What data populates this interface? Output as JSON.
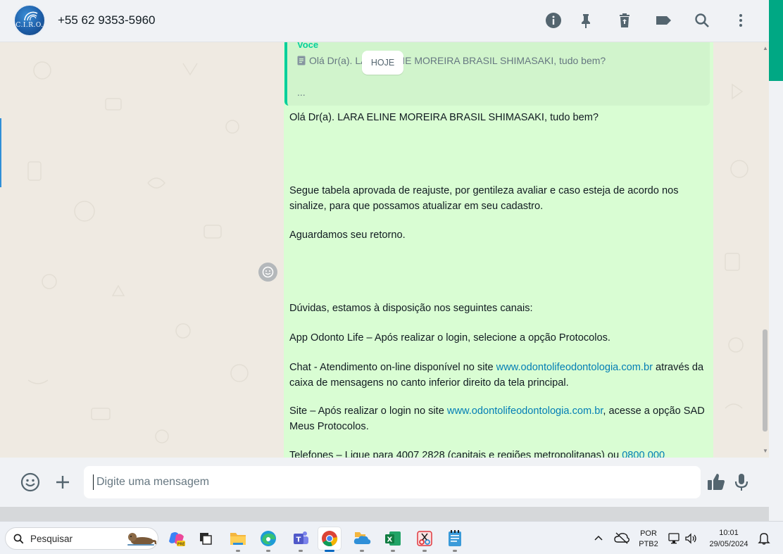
{
  "header": {
    "avatar_text": "C.I.R.O.",
    "contact_name": "+55 62 9353-5960",
    "icons": [
      "info-icon",
      "pin-icon",
      "delete-icon",
      "label-icon",
      "search-icon",
      "more-options-icon"
    ]
  },
  "chat": {
    "date_chip": "HOJE",
    "quoted": {
      "sender": "Você",
      "text": "Olá Dr(a). LARA ELINE MOREIRA BRASIL SHIMASAKI, tudo bem?",
      "ellipsis": "..."
    },
    "message": {
      "greeting": "Olá Dr(a). LARA ELINE MOREIRA BRASIL SHIMASAKI, tudo bem?",
      "p1": "Segue tabela aprovada de reajuste, por gentileza avaliar e caso esteja de acordo nos sinalize, para que possamos atualizar em seu cadastro.",
      "p2": "Aguardamos seu retorno.",
      "p3": "Dúvidas, estamos à disposição nos seguintes canais:",
      "p4": "App Odonto Life – Após realizar o login, selecione a opção Protocolos.",
      "p5_a": "Chat - Atendimento on-line disponível no site ",
      "p5_link": "www.odontolifeodontologia.com.br",
      "p5_b": " através da caixa de mensagens no canto inferior direito da tela principal.",
      "p6_a": "Site – Após realizar o login no site ",
      "p6_link": "www.odontolifeodontologia.com.br",
      "p6_b": ", acesse a opção SAD Meus Protocolos.",
      "p7_a": "Telefones – Ligue para 4007 2828 (capitais e regiões metropolitanas) ou ",
      "p7_link": "0800 000"
    }
  },
  "composer": {
    "placeholder": "Digite uma mensagem"
  },
  "taskbar": {
    "search_label": "Pesquisar",
    "apps": [
      "copilot",
      "task-view",
      "file-explorer",
      "edge",
      "teams",
      "chrome",
      "onedrive",
      "excel",
      "snipping-tool",
      "notepad"
    ],
    "lang_top": "POR",
    "lang_bottom": "PTB2",
    "time": "10:01",
    "date": "29/05/2024"
  }
}
